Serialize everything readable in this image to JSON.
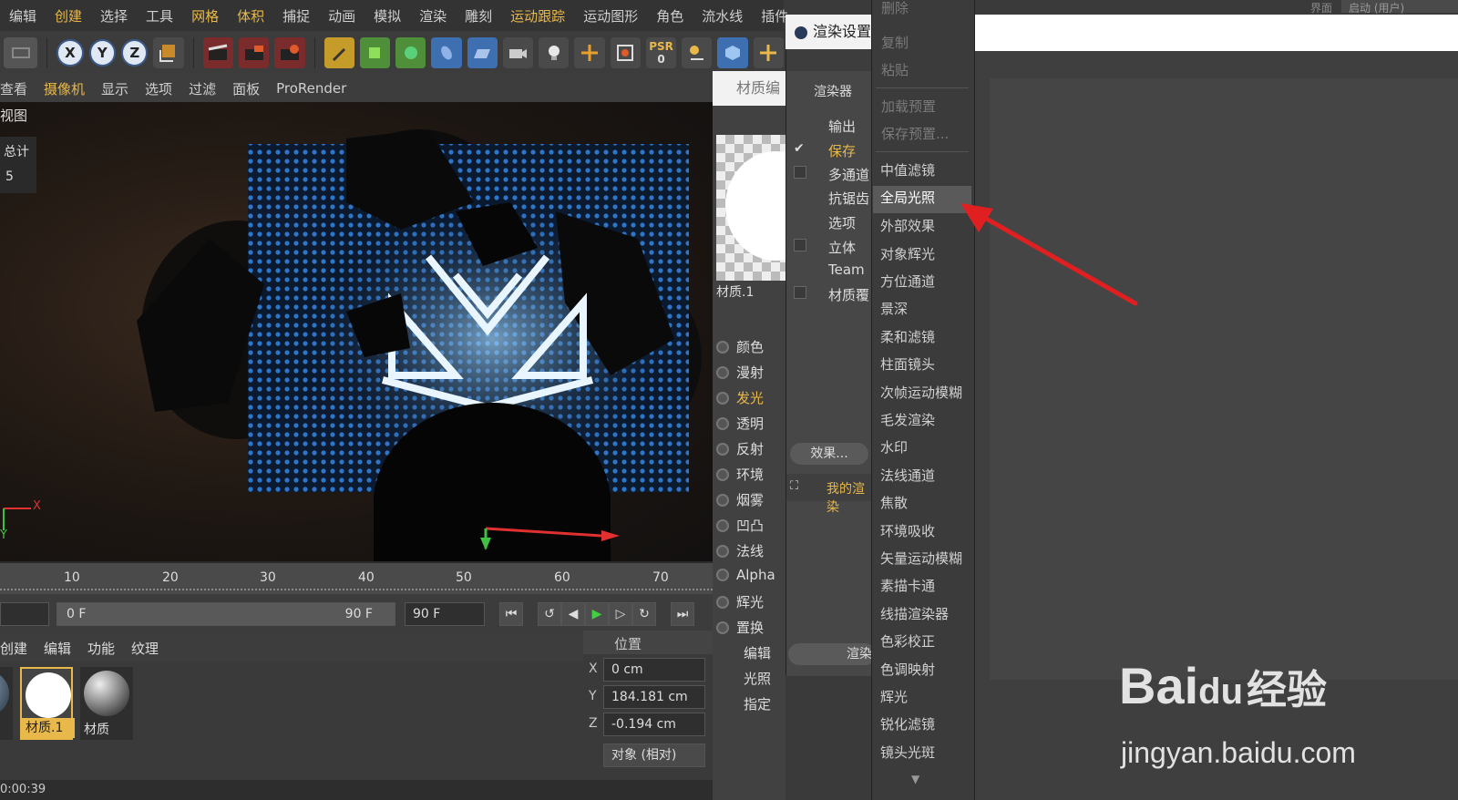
{
  "top_menu": [
    "编辑",
    "创建",
    "选择",
    "工具",
    "网格",
    "体积",
    "捕捉",
    "动画",
    "模拟",
    "渲染",
    "雕刻",
    "运动跟踪",
    "运动图形",
    "角色",
    "流水线",
    "插件"
  ],
  "toolbar": {
    "axis_x": "X",
    "axis_y": "Y",
    "axis_z": "Z",
    "psr": "PSR",
    "psr_val": "0"
  },
  "viewport_menu": [
    "查看",
    "摄像机",
    "显示",
    "选项",
    "过滤",
    "面板",
    "ProRender"
  ],
  "viewport": {
    "label": "视图",
    "stats_label": "总计",
    "stats_value": "5",
    "axis_x": "X",
    "axis_y": "Y"
  },
  "timeline": {
    "ticks": [
      "10",
      "20",
      "30",
      "40",
      "50",
      "60",
      "70"
    ],
    "frame_start": "0 F",
    "frame_end": "90 F",
    "frame_field": "90 F"
  },
  "material_manager": {
    "menu": [
      "创建",
      "编辑",
      "功能",
      "纹理"
    ],
    "materials": [
      "材质.1",
      "材质"
    ]
  },
  "coordinates": {
    "header": "位置",
    "x_label": "X",
    "x_value": "0 cm",
    "y_label": "Y",
    "y_value": "184.181 cm",
    "z_label": "Z",
    "z_value": "-0.194 cm",
    "mode": "对象 (相对)"
  },
  "status": {
    "time": "0:00:39"
  },
  "material_editor": {
    "title": "材质编",
    "name": "材质.1",
    "channels": [
      "颜色",
      "漫射",
      "发光",
      "透明",
      "反射",
      "环境",
      "烟雾",
      "凹凸",
      "法线",
      "Alpha",
      "辉光",
      "置换",
      "编辑",
      "光照",
      "指定"
    ]
  },
  "render_settings": {
    "title": "渲染设置",
    "renderer_label": "渲染器",
    "tree": [
      "输出",
      "保存",
      "多通道",
      "抗锯齿",
      "选项",
      "立体",
      "Team",
      "材质覆"
    ],
    "effects_button": "效果...",
    "preset": "我的渲染",
    "render_button": "渲染"
  },
  "context_menu": {
    "disabled": [
      "删除",
      "复制",
      "粘贴",
      "加载预置",
      "保存预置..."
    ],
    "items": [
      "中值滤镜",
      "全局光照",
      "外部效果",
      "对象辉光",
      "方位通道",
      "景深",
      "柔和滤镜",
      "柱面镜头",
      "次帧运动模糊",
      "毛发渲染",
      "水印",
      "法线通道",
      "焦散",
      "环境吸收",
      "矢量运动模糊",
      "素描卡通",
      "线描渲染器",
      "色彩校正",
      "色调映射",
      "辉光",
      "锐化滤镜",
      "镜头光斑"
    ],
    "highlighted": "全局光照"
  },
  "right_window": {
    "label": "界面",
    "layout": "启动 (用户)"
  },
  "watermark": {
    "logo": "Bai",
    "logo_paw": "du",
    "logo_cn": "经验",
    "url": "jingyan.baidu.com"
  },
  "colors": {
    "accent": "#e8b84a",
    "arrow": "#e02020",
    "menu_highlight": "#5a5a5a"
  }
}
